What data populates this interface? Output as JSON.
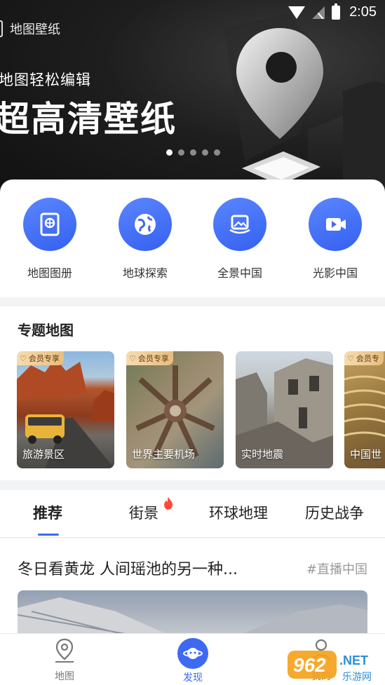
{
  "status_bar": {
    "time": "2:05"
  },
  "banner": {
    "app_name": "地图壁纸",
    "subtitle": "地图轻松编辑",
    "title": "超高清壁纸",
    "dots_total": 5,
    "dots_active": 1
  },
  "quick_entries": [
    {
      "label": "地图图册",
      "icon": "album-icon"
    },
    {
      "label": "地球探索",
      "icon": "globe-icon"
    },
    {
      "label": "全景中国",
      "icon": "panorama-icon"
    },
    {
      "label": "光影中国",
      "icon": "video-icon"
    }
  ],
  "topic_section": {
    "title": "专题地图",
    "cards": [
      {
        "label": "旅游景区",
        "badge": "会员专享"
      },
      {
        "label": "世界主要机场",
        "badge": "会员专享"
      },
      {
        "label": "实时地震",
        "badge": ""
      },
      {
        "label": "中国世",
        "badge": "会员专"
      }
    ]
  },
  "tabs": [
    {
      "label": "推荐",
      "active": true
    },
    {
      "label": "街景",
      "active": false,
      "hot": true
    },
    {
      "label": "环球地理",
      "active": false
    },
    {
      "label": "历史战争",
      "active": false
    }
  ],
  "feed": {
    "title": "冬日看黄龙 人间瑶池的另一种...",
    "tag": "#直播中国"
  },
  "bottom_nav": [
    {
      "label": "地图",
      "active": false
    },
    {
      "label": "发现",
      "active": true
    },
    {
      "label": "我的",
      "active": false
    }
  ],
  "watermark": {
    "text": "962.NET",
    "sub": "乐游网"
  },
  "colors": {
    "accent": "#3d6af2",
    "badge_gold": "#e8bd7d"
  }
}
